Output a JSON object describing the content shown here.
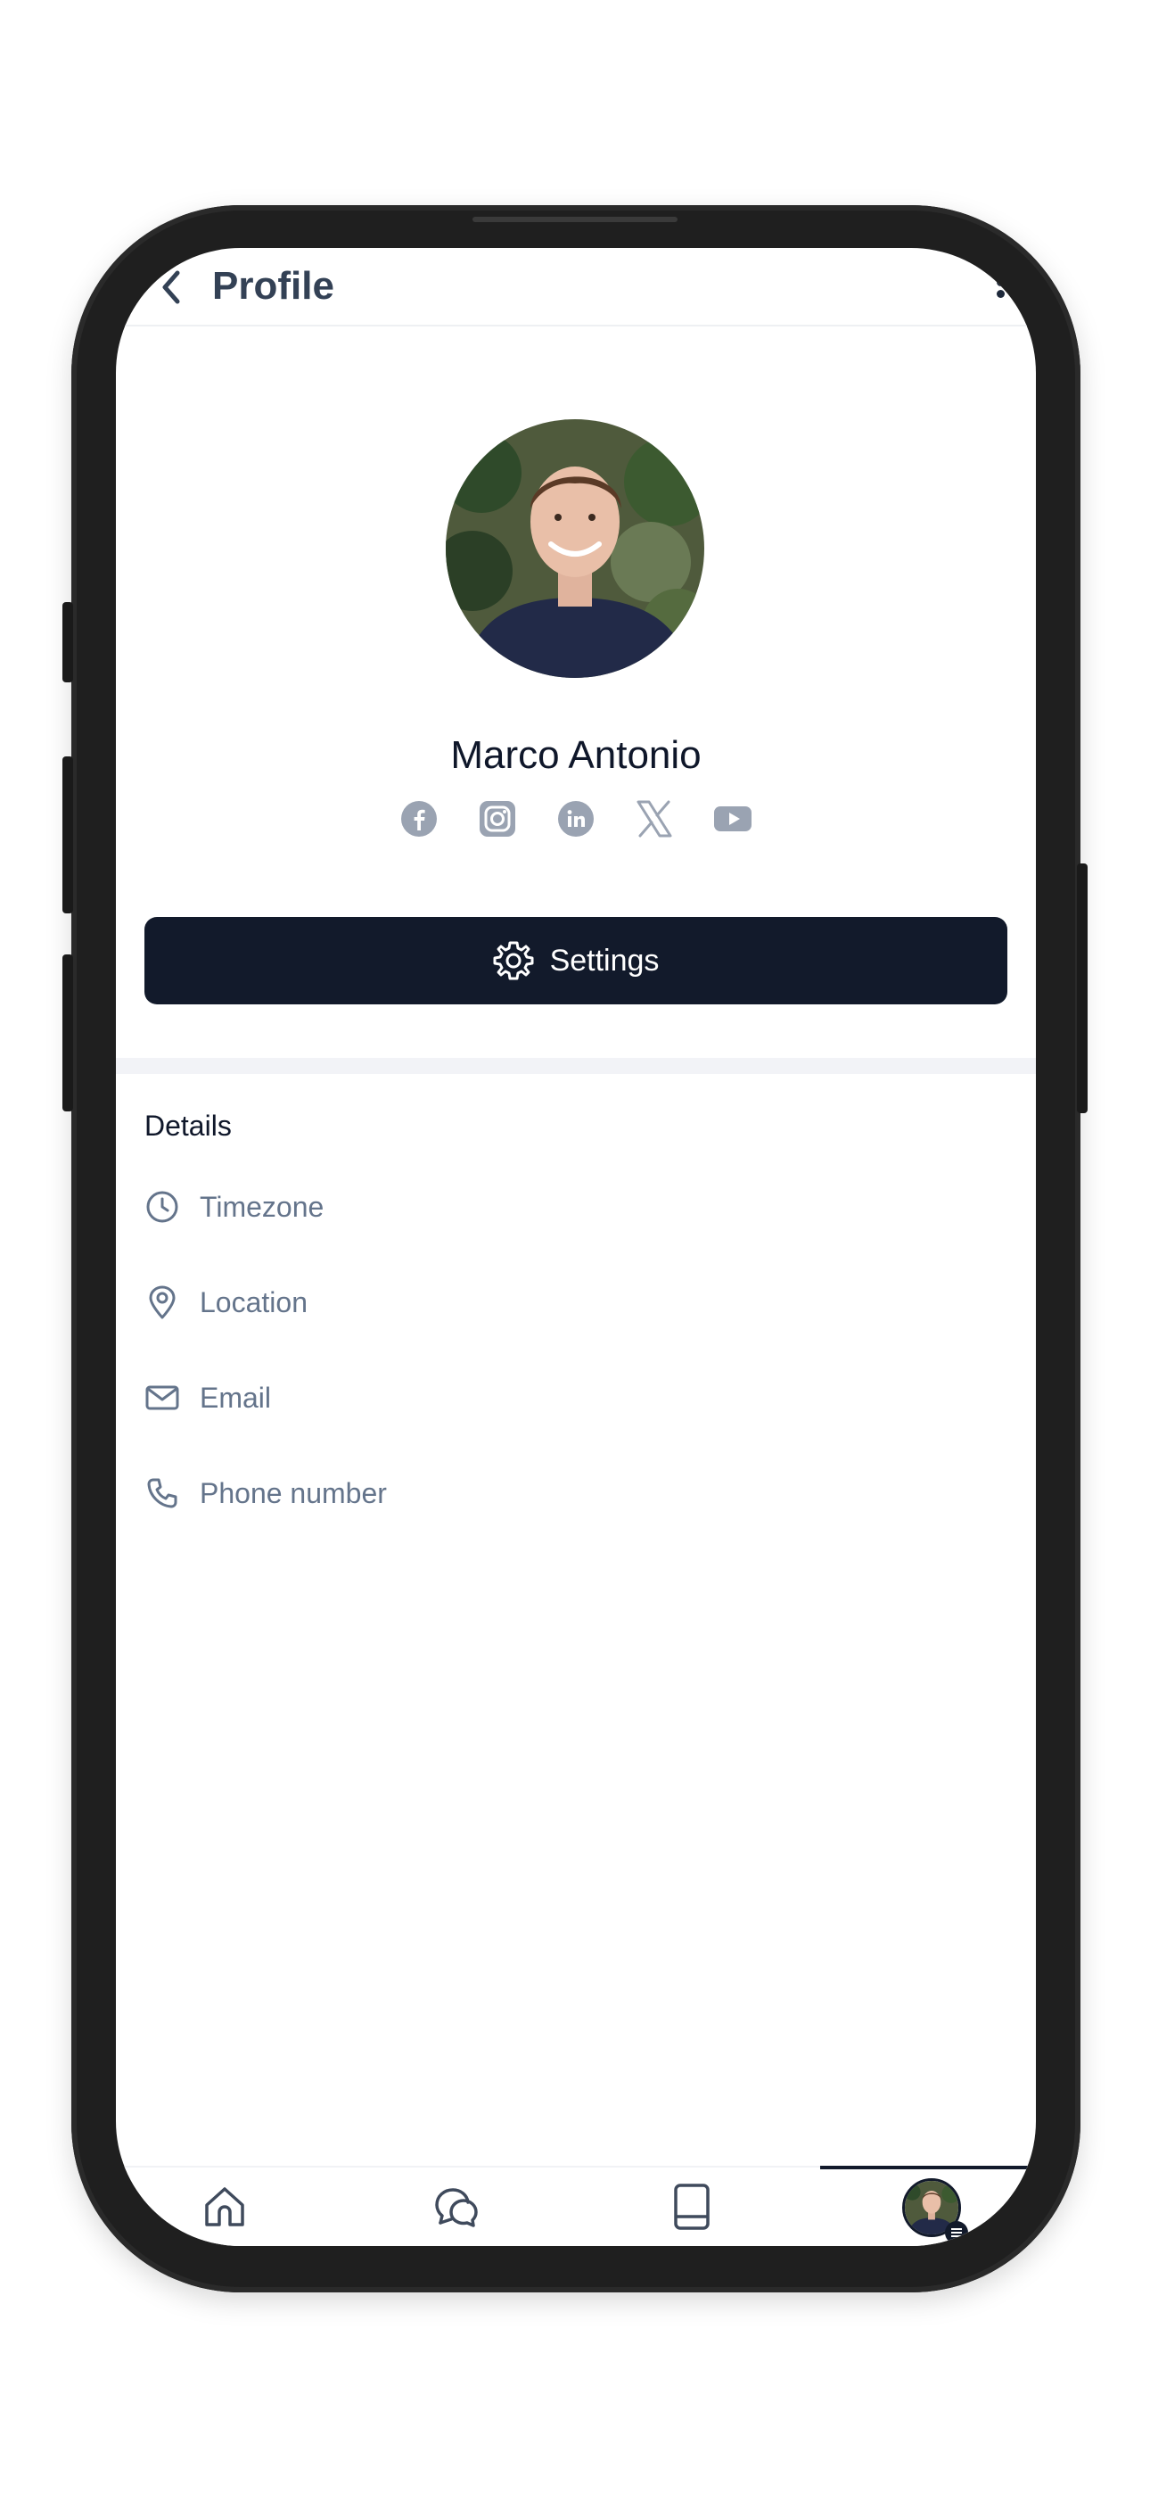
{
  "header": {
    "title": "Profile"
  },
  "profile": {
    "name": "Marco Antonio"
  },
  "socials": [
    "facebook-icon",
    "instagram-icon",
    "linkedin-icon",
    "x-icon",
    "youtube-icon"
  ],
  "settings": {
    "label": "Settings"
  },
  "details": {
    "title": "Details",
    "items": [
      {
        "icon": "clock-icon",
        "label": "Timezone"
      },
      {
        "icon": "location-pin-icon",
        "label": "Location"
      },
      {
        "icon": "mail-icon",
        "label": "Email"
      },
      {
        "icon": "phone-icon",
        "label": "Phone number"
      }
    ]
  },
  "nav": {
    "items": [
      "home-icon",
      "chat-icon",
      "book-icon",
      "profile-avatar"
    ],
    "active_index": 3
  },
  "colors": {
    "primary": "#121a2b",
    "icon_gray": "#9aa3b2",
    "text_muted": "#64748b"
  }
}
